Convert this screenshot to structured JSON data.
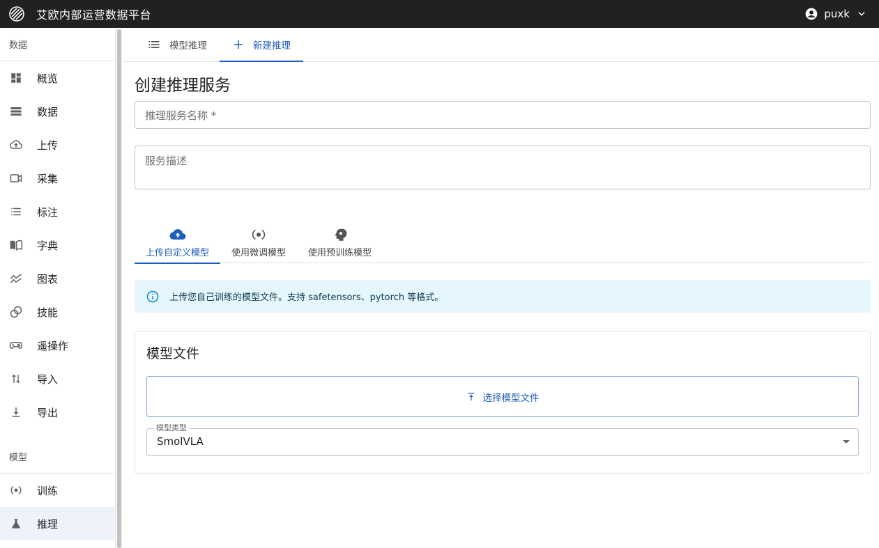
{
  "app": {
    "title": "艾欧内部运营数据平台"
  },
  "user": {
    "name": "puxk"
  },
  "sidebar": {
    "sections": [
      {
        "header": "数据",
        "items": [
          {
            "label": "概览",
            "icon": "dashboard-icon"
          },
          {
            "label": "数据",
            "icon": "storage-icon"
          },
          {
            "label": "上传",
            "icon": "cloud-upload-icon"
          },
          {
            "label": "采集",
            "icon": "video-camera-icon"
          },
          {
            "label": "标注",
            "icon": "list-icon"
          },
          {
            "label": "字典",
            "icon": "book-icon"
          },
          {
            "label": "图表",
            "icon": "chart-icon"
          },
          {
            "label": "技能",
            "icon": "skill-icon"
          },
          {
            "label": "遥操作",
            "icon": "gamepad-icon"
          },
          {
            "label": "导入",
            "icon": "import-arrows-icon"
          },
          {
            "label": "导出",
            "icon": "download-icon"
          }
        ]
      },
      {
        "header": "模型",
        "items": [
          {
            "label": "训练",
            "icon": "training-icon"
          },
          {
            "label": "推理",
            "icon": "flask-icon",
            "active": true
          }
        ]
      }
    ]
  },
  "tabs": {
    "list": "模型推理",
    "create": "新建推理"
  },
  "form": {
    "title": "创建推理服务",
    "name_placeholder": "推理服务名称 *",
    "desc_placeholder": "服务描述"
  },
  "source_tabs": {
    "upload": "上传自定义模型",
    "finetune": "使用微调模型",
    "pretrained": "使用预训练模型"
  },
  "alert": {
    "text": "上传您自己训练的模型文件。支持 safetensors、pytorch 等格式。"
  },
  "model_card": {
    "title": "模型文件",
    "upload_label": "选择模型文件",
    "type_label": "模型类型",
    "type_value": "SmolVLA"
  },
  "colors": {
    "accent": "#1e5ebd",
    "topbar": "#212121",
    "alert_bg": "#e5f6fd"
  }
}
